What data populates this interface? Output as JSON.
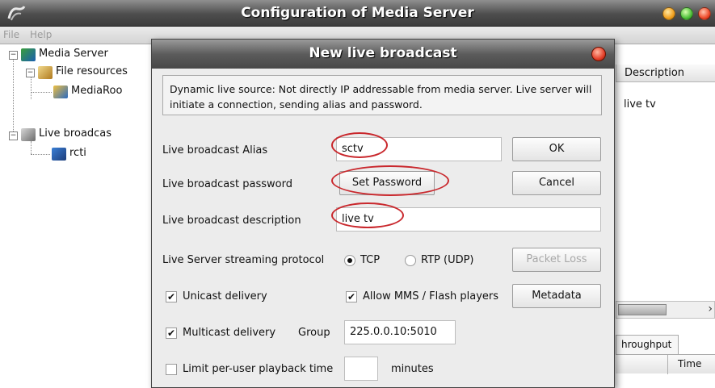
{
  "main_window": {
    "title": "Configuration of Media Server",
    "menu": {
      "file": "File",
      "help": "Help"
    }
  },
  "tree": {
    "root": "Media Server",
    "file_resources": "File resources",
    "media_root": "MediaRoo",
    "live_broadcasts": "Live broadcas",
    "rcti": "rcti"
  },
  "right_panel": {
    "description_header": "Description",
    "description_value": "live tv",
    "throughput_tab": "hroughput",
    "time_header": "Time",
    "scroll_right_glyph": "›"
  },
  "dialog": {
    "title": "New live broadcast",
    "info": "Dynamic live source: Not directly IP addressable from media server. Live server will initiate a connection, sending alias and password.",
    "alias_label": "Live broadcast Alias",
    "alias_value": "sctv",
    "password_label": "Live broadcast password",
    "set_password_button": "Set Password",
    "description_label": "Live broadcast description",
    "description_value": "live tv",
    "protocol_label": "Live Server streaming protocol",
    "protocol_tcp": "TCP",
    "protocol_rtp": "RTP (UDP)",
    "protocol_selected": "TCP",
    "unicast_label": "Unicast delivery",
    "unicast_checked": true,
    "allow_mms_label": "Allow MMS / Flash players",
    "allow_mms_checked": true,
    "multicast_label": "Multicast delivery",
    "multicast_checked": true,
    "group_label": "Group",
    "group_value": "225.0.0.10:5010",
    "limit_label": "Limit per-user playback time",
    "limit_checked": false,
    "minutes_value": "",
    "minutes_label": "minutes",
    "ok_button": "OK",
    "cancel_button": "Cancel",
    "packet_loss_button": "Packet Loss",
    "metadata_button": "Metadata",
    "check_glyph": "✔"
  },
  "colors": {
    "annotation_circle": "#c9282d",
    "title_bar": "#4d4d4d",
    "dialog_background": "#ececec"
  }
}
